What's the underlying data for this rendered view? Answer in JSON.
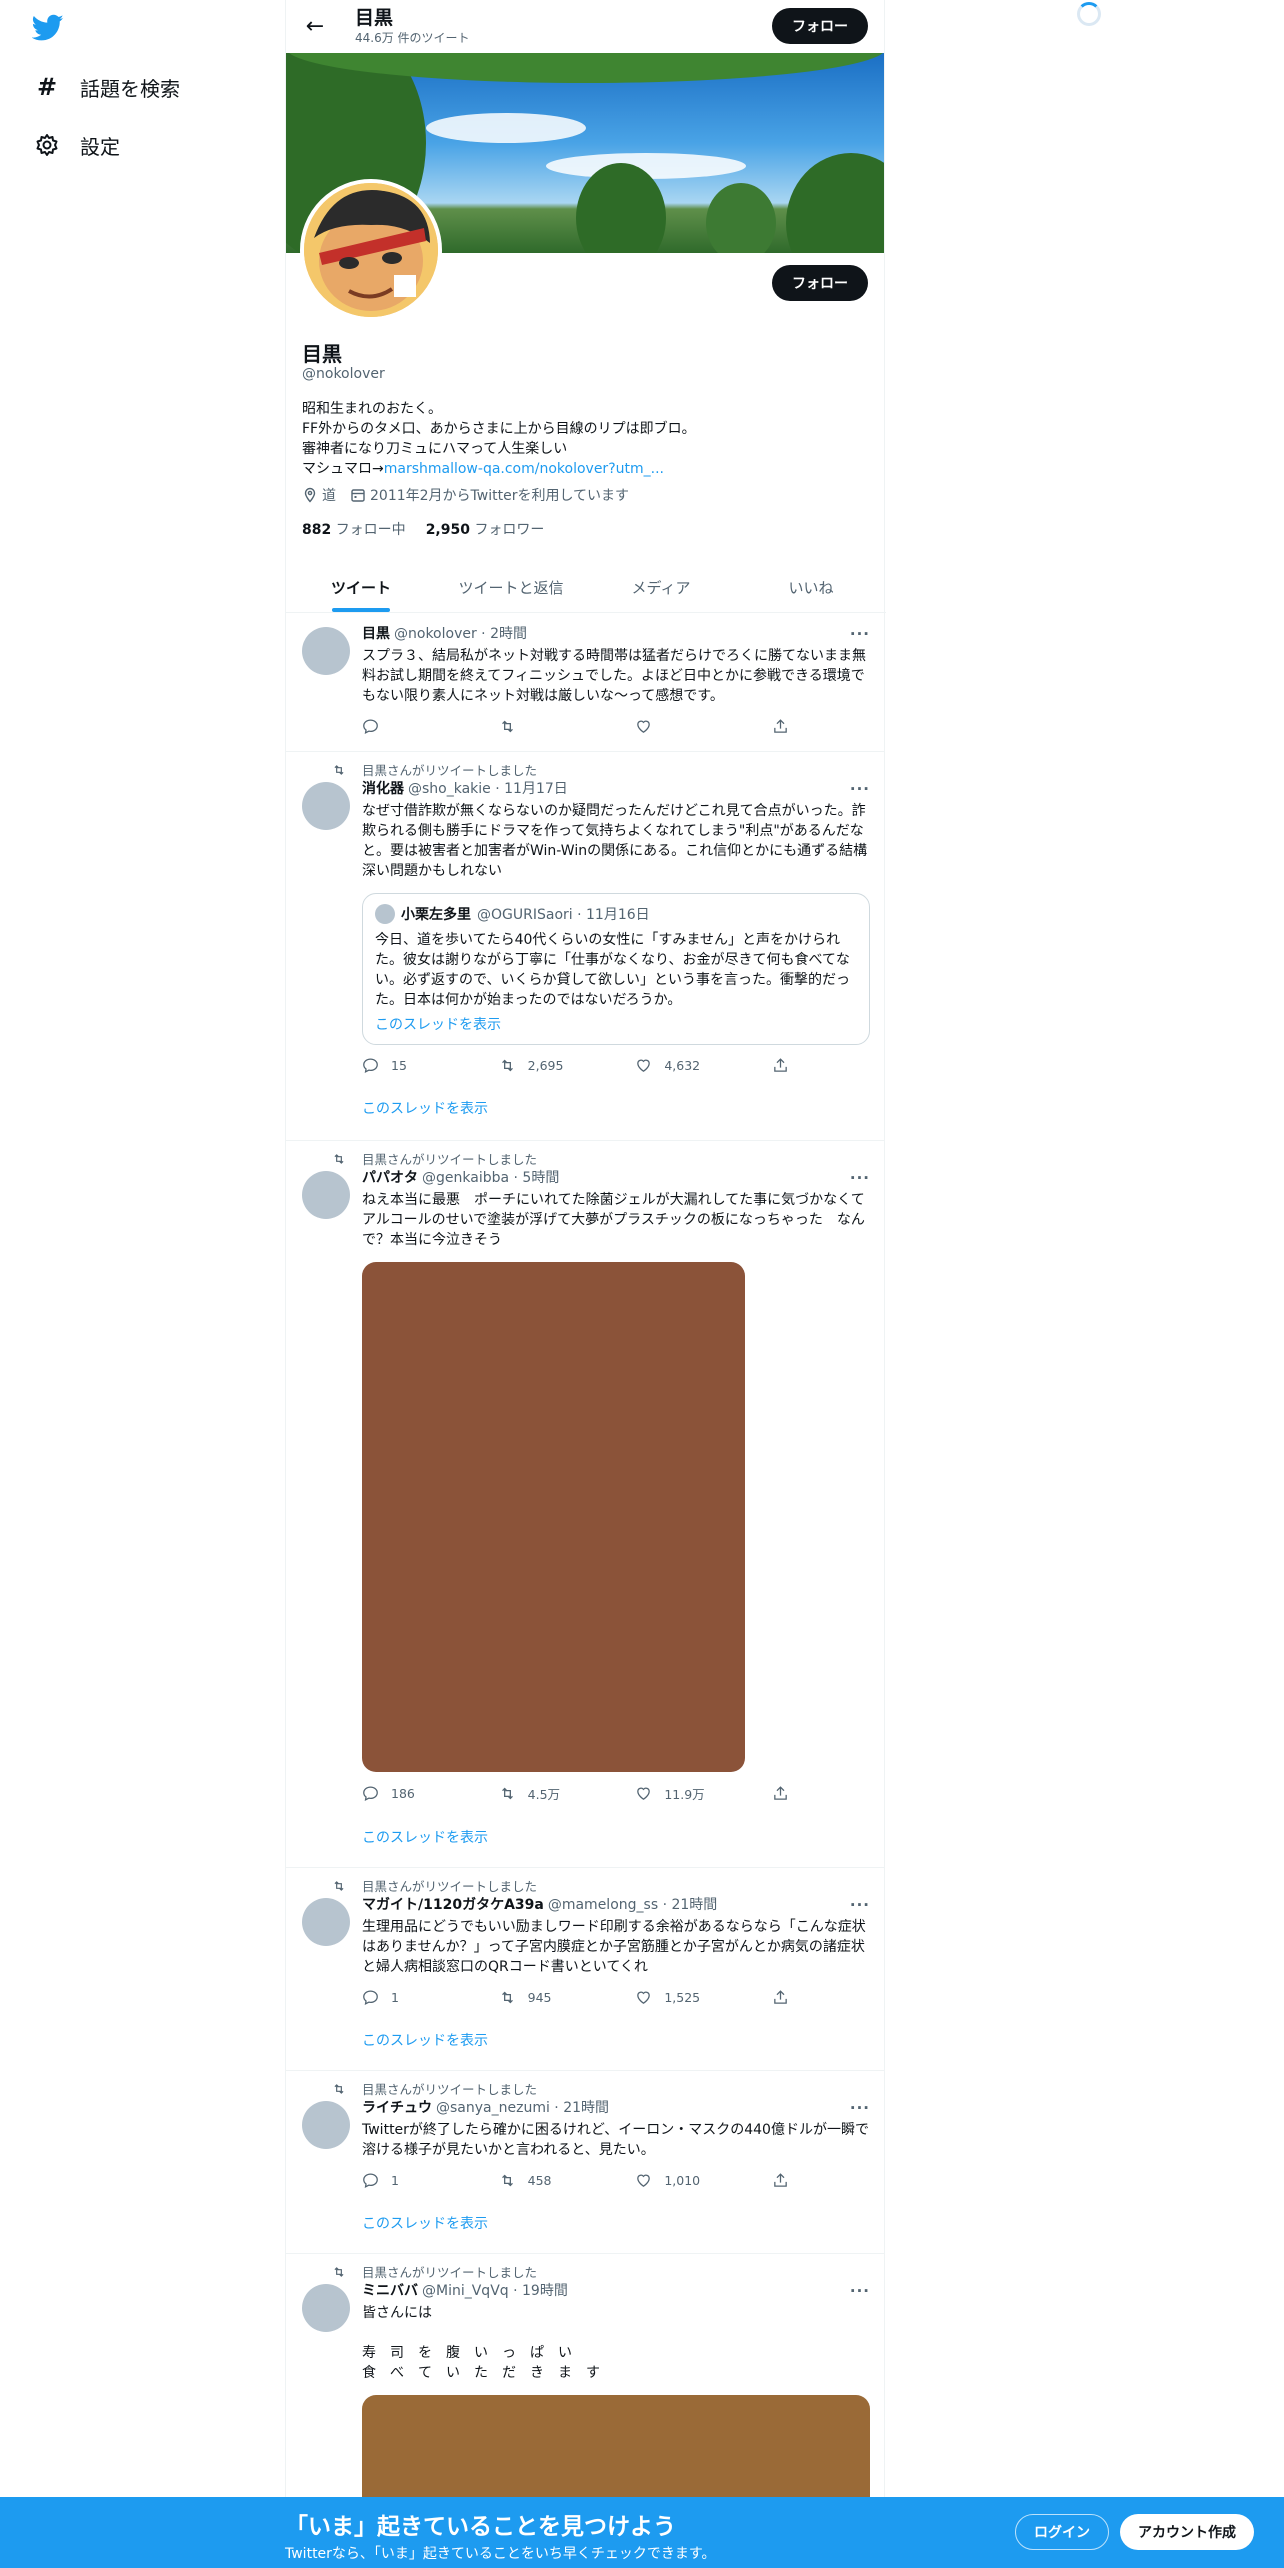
{
  "sidebar": {
    "items": [
      {
        "icon": "hashtag-icon",
        "label": "話題を検索"
      },
      {
        "icon": "gear-icon",
        "label": "設定"
      }
    ]
  },
  "header": {
    "name": "目黒",
    "tweet_count": "44.6万 件のツイート",
    "follow_label": "フォロー"
  },
  "profile": {
    "name": "目黒",
    "handle": "@nokolover",
    "follow_label": "フォロー",
    "bio_lines": [
      "昭和生まれのおたく。",
      "FF外からのタメ口、あからさまに上から目線のリプは即ブロ。",
      "審神者になり刀ミュにハマって人生楽しい"
    ],
    "bio_link_prefix": "マシュマロ→",
    "bio_link": "marshmallow-qa.com/nokolover?utm_...",
    "location": "道",
    "joined": "2011年2月からTwitterを利用しています",
    "following_count": "882",
    "following_label": "フォロー中",
    "followers_count": "2,950",
    "followers_label": "フォロワー"
  },
  "tabs": [
    "ツイート",
    "ツイートと返信",
    "メディア",
    "いいね"
  ],
  "tweets": [
    {
      "name": "目黒",
      "handle": "@nokolover · 2時間",
      "text": "スプラ３、結局私がネット対戦する時間帯は猛者だらけでろくに勝てないまま無料お試し期間を終えてフィニッシュでした。よほど日中とかに参戦できる環境でもない限り素人にネット対戦は厳しいな～って感想です。",
      "replies": "",
      "retweets": "",
      "likes": ""
    },
    {
      "retweeted_by": "目黒さんがリツイートしました",
      "name": "消化器",
      "handle": "@sho_kakie · 11月17日",
      "text": "なぜ寸借詐欺が無くならないのか疑問だったんだけどこれ見て合点がいった。詐欺られる側も勝手にドラマを作って気持ちよくなれてしまう\"利点\"があるんだなと。要は被害者と加害者がWin-Winの関係にある。これ信仰とかにも通ずる結構深い問題かもしれない",
      "quote": {
        "name": "小栗左多里",
        "handle": "@OGURISaori · 11月16日",
        "text": "今日、道を歩いてたら40代くらいの女性に「すみません」と声をかけられた。彼女は謝りながら丁寧に「仕事がなくなり、お金が尽きて何も食べてない。必ず返すので、いくらか貸して欲しい」という事を言った。衝撃的だった。日本は何かが始まったのではないだろうか。",
        "show_thread": "このスレッドを表示"
      },
      "replies": "15",
      "retweets": "2,695",
      "likes": "4,632",
      "show_thread": "このスレッドを表示"
    },
    {
      "retweeted_by": "目黒さんがリツイートしました",
      "name": "パパオタ",
      "handle": "@genkaibba · 5時間",
      "text": "ねえ本当に最悪　ポーチにいれてた除菌ジェルが大漏れしてた事に気づかなくてアルコールのせいで塗装が浮げて大夢がプラスチックの板になっちゃった　なんで？本当に今泣きそう",
      "media_color": "#8b5339",
      "replies": "186",
      "retweets": "4.5万",
      "likes": "11.9万",
      "show_thread": "このスレッドを表示"
    },
    {
      "retweeted_by": "目黒さんがリツイートしました",
      "name": "マガイト/1120ガタケA39a",
      "handle": "@mamelong_ss · 21時間",
      "text": "生理用品にどうでもいい励ましワード印刷する余裕があるならなら「こんな症状はありませんか？」って子宮内膜症とか子宮筋腫とか子宮がんとか病気の諸症状と婦人病相談窓口のQRコード書いといてくれ",
      "replies": "1",
      "retweets": "945",
      "likes": "1,525",
      "show_thread": "このスレッドを表示"
    },
    {
      "retweeted_by": "目黒さんがリツイートしました",
      "name": "ライチュウ",
      "handle": "@sanya_nezumi · 21時間",
      "text": "Twitterが終了したら確かに困るけれど、イーロン・マスクの440億ドルが一瞬で溶ける様子が見たいかと言われると、見たい。",
      "replies": "1",
      "retweets": "458",
      "likes": "1,010",
      "show_thread": "このスレッドを表示"
    },
    {
      "retweeted_by": "目黒さんがリツイートしました",
      "name": "ミニババ",
      "handle": "@Mini_VqVq · 19時間",
      "text": "皆さんには\n\n寿　司　を　腹　い　っ　ぱ　い\n食　べ　て　い　た　だ　き　ま　す",
      "media_color": "#9a6a37"
    }
  ],
  "bottom_bar": {
    "title": "「いま」起きていることを見つけよう",
    "subtitle": "Twitterなら、「いま」起きていることをいち早くチェックできます。",
    "login_label": "ログイン",
    "signup_label": "アカウント作成"
  }
}
